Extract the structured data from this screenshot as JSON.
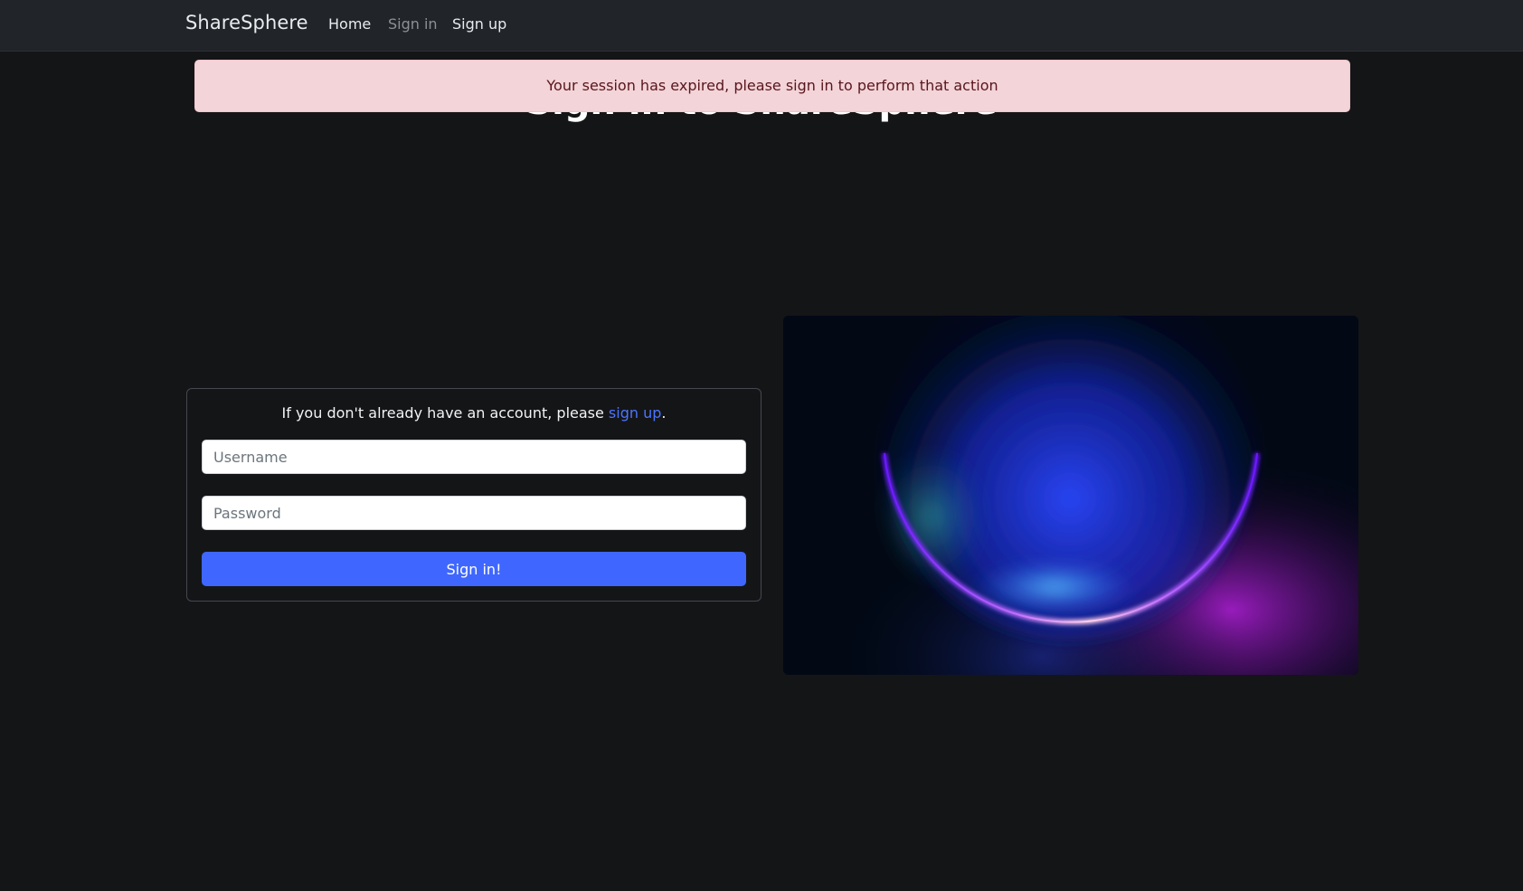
{
  "navbar": {
    "brand": "ShareSphere",
    "links": {
      "home": "Home",
      "sign_in": "Sign in",
      "sign_up": "Sign up"
    }
  },
  "page": {
    "heading": "Sign in to ShareSphere"
  },
  "alert": {
    "message": "Your session has expired, please sign in to perform that action",
    "color": "#f3d4d8"
  },
  "signin_form": {
    "intro_prefix": "If you don't already have an account, please ",
    "intro_link": "sign up",
    "intro_suffix": ".",
    "username_placeholder": "Username",
    "password_placeholder": "Password",
    "username_value": "",
    "password_value": "",
    "submit_label": "Sign in!"
  },
  "colors": {
    "background": "#141517",
    "navbar": "#212429",
    "primary": "#3f67ff",
    "link": "#4d74ff"
  }
}
